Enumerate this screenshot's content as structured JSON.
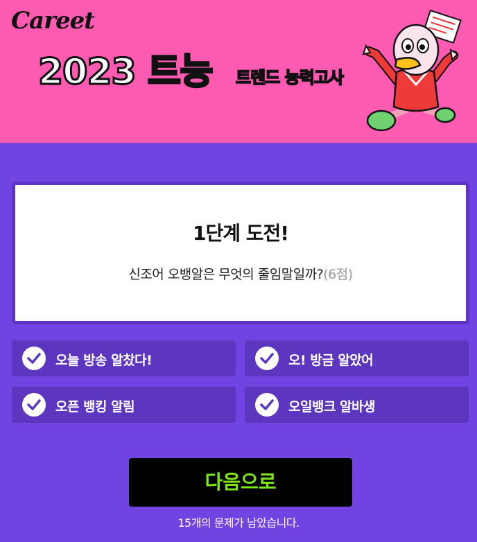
{
  "header": {
    "logo_text": "Careet",
    "year_title": "2023 트능",
    "subtitle_part1": "트",
    "subtitle_part2": "렌드 ",
    "subtitle_part3": "능",
    "subtitle_part4": "력고사",
    "mascot_icon": "duck-mascot-icon",
    "bg_color": "#fd5ab1",
    "accent_color": "#7dea16"
  },
  "question": {
    "stage_title": "1단계 도전!",
    "text": "신조어 오뱅알은 무엇의 줄임말일까?",
    "points": "(6점)"
  },
  "options": [
    {
      "label": "오늘 방송 알찼다!",
      "icon": "check-circle-icon"
    },
    {
      "label": "오! 방금 알았어",
      "icon": "check-circle-icon"
    },
    {
      "label": "오픈 뱅킹 알림",
      "icon": "check-circle-icon"
    },
    {
      "label": "오일뱅크 알바생",
      "icon": "check-circle-icon"
    }
  ],
  "footer": {
    "next_button_label": "다음으로",
    "remaining_text": "15개의 문제가 남았습니다."
  },
  "colors": {
    "background": "#7143e0",
    "option_bg": "#5c36be",
    "check_color": "#5c36be"
  }
}
